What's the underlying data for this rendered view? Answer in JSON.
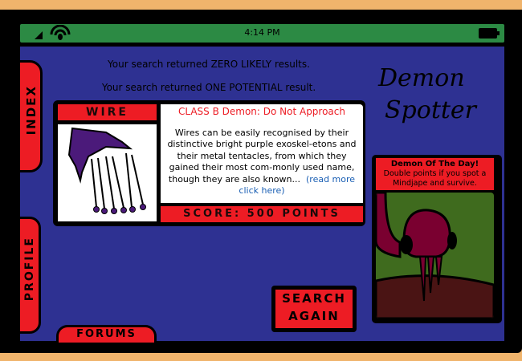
{
  "status_bar": {
    "time": "4:14 PM",
    "icons": [
      "signal-icon",
      "wifi-icon",
      "battery-icon"
    ]
  },
  "results": {
    "likely": "Your search returned ZERO LIKELY results.",
    "potential": "Your search returned ONE POTENTIAL result."
  },
  "logo": {
    "line1": "Demon",
    "line2": "Spotter"
  },
  "nav": {
    "index": "INDEX",
    "profile": "PROFILE",
    "forums": "FORUMS"
  },
  "result_card": {
    "name": "WIRE",
    "class_label": "CLASS B Demon: Do Not Approach",
    "description": "Wires can be easily recognised by their distinctive bright purple exoskel-etons and their metal tentacles, from which they gained their most com-monly used name, though they are also known...",
    "read_more": "(read more click here)",
    "score": "SCORE: 500 POINTS"
  },
  "demon_of_day": {
    "title": "Demon Of The Day!",
    "text": "Double points if you spot a Mindjape and survive."
  },
  "search_again": {
    "line1": "SEARCH",
    "line2": "AGAIN"
  },
  "colors": {
    "background": "#f0b46c",
    "screen": "#2e3192",
    "status": "#2c8a44",
    "accent": "#ed1c24",
    "link": "#1a5fb4"
  }
}
